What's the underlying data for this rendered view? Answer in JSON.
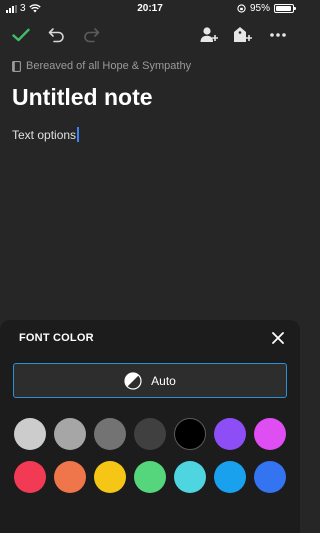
{
  "status_bar": {
    "carrier": "3",
    "time": "20:17",
    "battery_text": "95%",
    "battery_level": 0.95
  },
  "toolbar": {
    "done_icon": "checkmark-icon",
    "undo_icon": "undo-icon",
    "redo_icon": "redo-icon",
    "share_icon": "add-person-icon",
    "tag_icon": "add-tag-icon",
    "more_icon": "more-icon",
    "accent_color": "#3fbf6a"
  },
  "note": {
    "notebook_icon": "notebook-icon",
    "notebook": "Bereaved of all Hope & Sympathy",
    "title": "Untitled note",
    "body": "Text options"
  },
  "font_color_panel": {
    "title": "FONT COLOR",
    "close_icon": "close-icon",
    "auto_label": "Auto",
    "auto_icon": "half-circle-icon",
    "selected_border_color": "#2d8fd5",
    "swatches": [
      "#cccccc",
      "#a6a6a6",
      "#737373",
      "#404040",
      "#000000",
      "#8e4ef5",
      "#de4ef2",
      "#f23a54",
      "#ef754b",
      "#f5c616",
      "#56d67c",
      "#4ed5e0",
      "#1aa1ee",
      "#3474f0"
    ]
  }
}
